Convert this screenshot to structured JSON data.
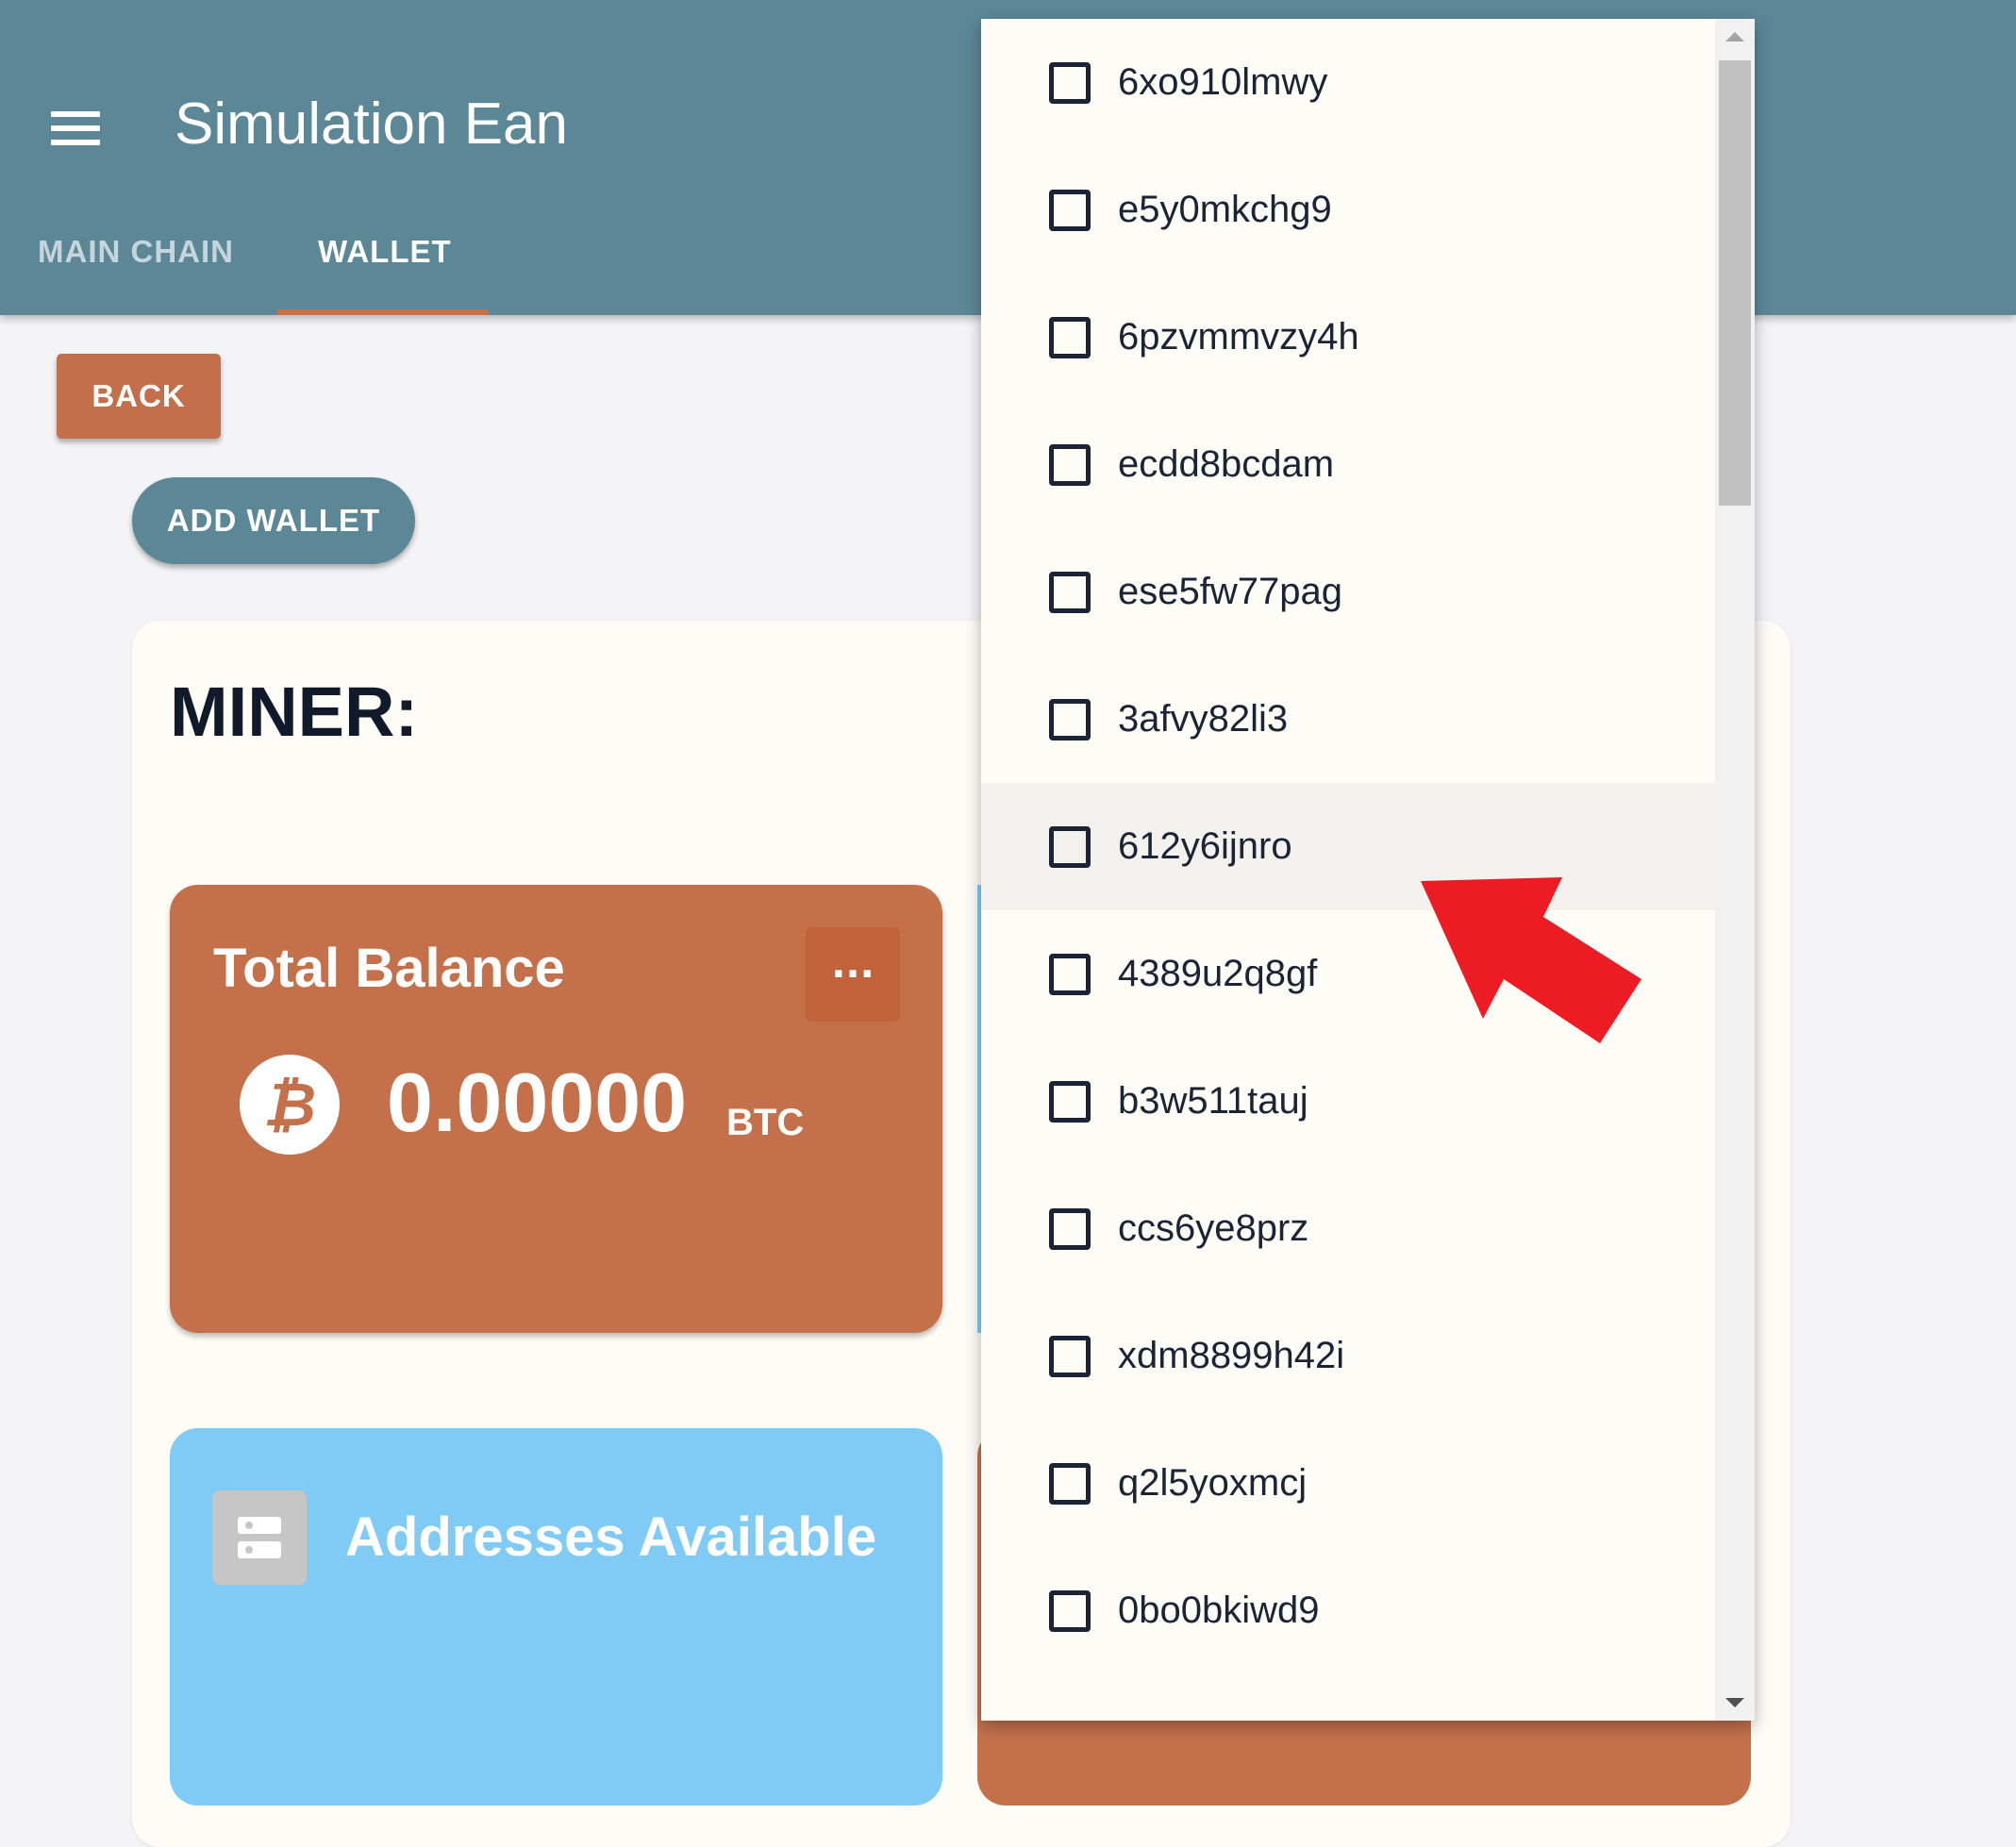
{
  "header": {
    "title": "Simulation Ean",
    "tabs": [
      {
        "label": "MAIN CHAIN",
        "active": false
      },
      {
        "label": "WALLET",
        "active": true
      }
    ]
  },
  "actions": {
    "back_label": "BACK",
    "add_wallet_label": "ADD WALLET"
  },
  "miner": {
    "title": "MINER:",
    "balance_card": {
      "title": "Total Balance",
      "more_label": "···",
      "currency_icon": "bitcoin-icon",
      "amount": "0.00000",
      "unit": "BTC"
    },
    "addresses_card": {
      "icon": "server-icon",
      "title": "Addresses Available"
    }
  },
  "dropdown": {
    "items": [
      {
        "label": "6xo910lmwy",
        "checked": false
      },
      {
        "label": "e5y0mkchg9",
        "checked": false
      },
      {
        "label": "6pzvmmvzy4h",
        "checked": false
      },
      {
        "label": "ecdd8bcdam",
        "checked": false
      },
      {
        "label": "ese5fw77pag",
        "checked": false
      },
      {
        "label": "3afvy82li3",
        "checked": false
      },
      {
        "label": "612y6ijnro",
        "checked": false,
        "hovered": true
      },
      {
        "label": "4389u2q8gf",
        "checked": false
      },
      {
        "label": "b3w511tauj",
        "checked": false
      },
      {
        "label": "ccs6ye8prz",
        "checked": false
      },
      {
        "label": "xdm8899h42i",
        "checked": false
      },
      {
        "label": "q2l5yoxmcj",
        "checked": false
      },
      {
        "label": "0bo0bkiwd9",
        "checked": false
      }
    ]
  },
  "colors": {
    "appbar": "#5b8797",
    "accent_orange": "#c4714b",
    "card_blue": "#7fcbf6",
    "annotation_arrow": "#ed1c24"
  }
}
